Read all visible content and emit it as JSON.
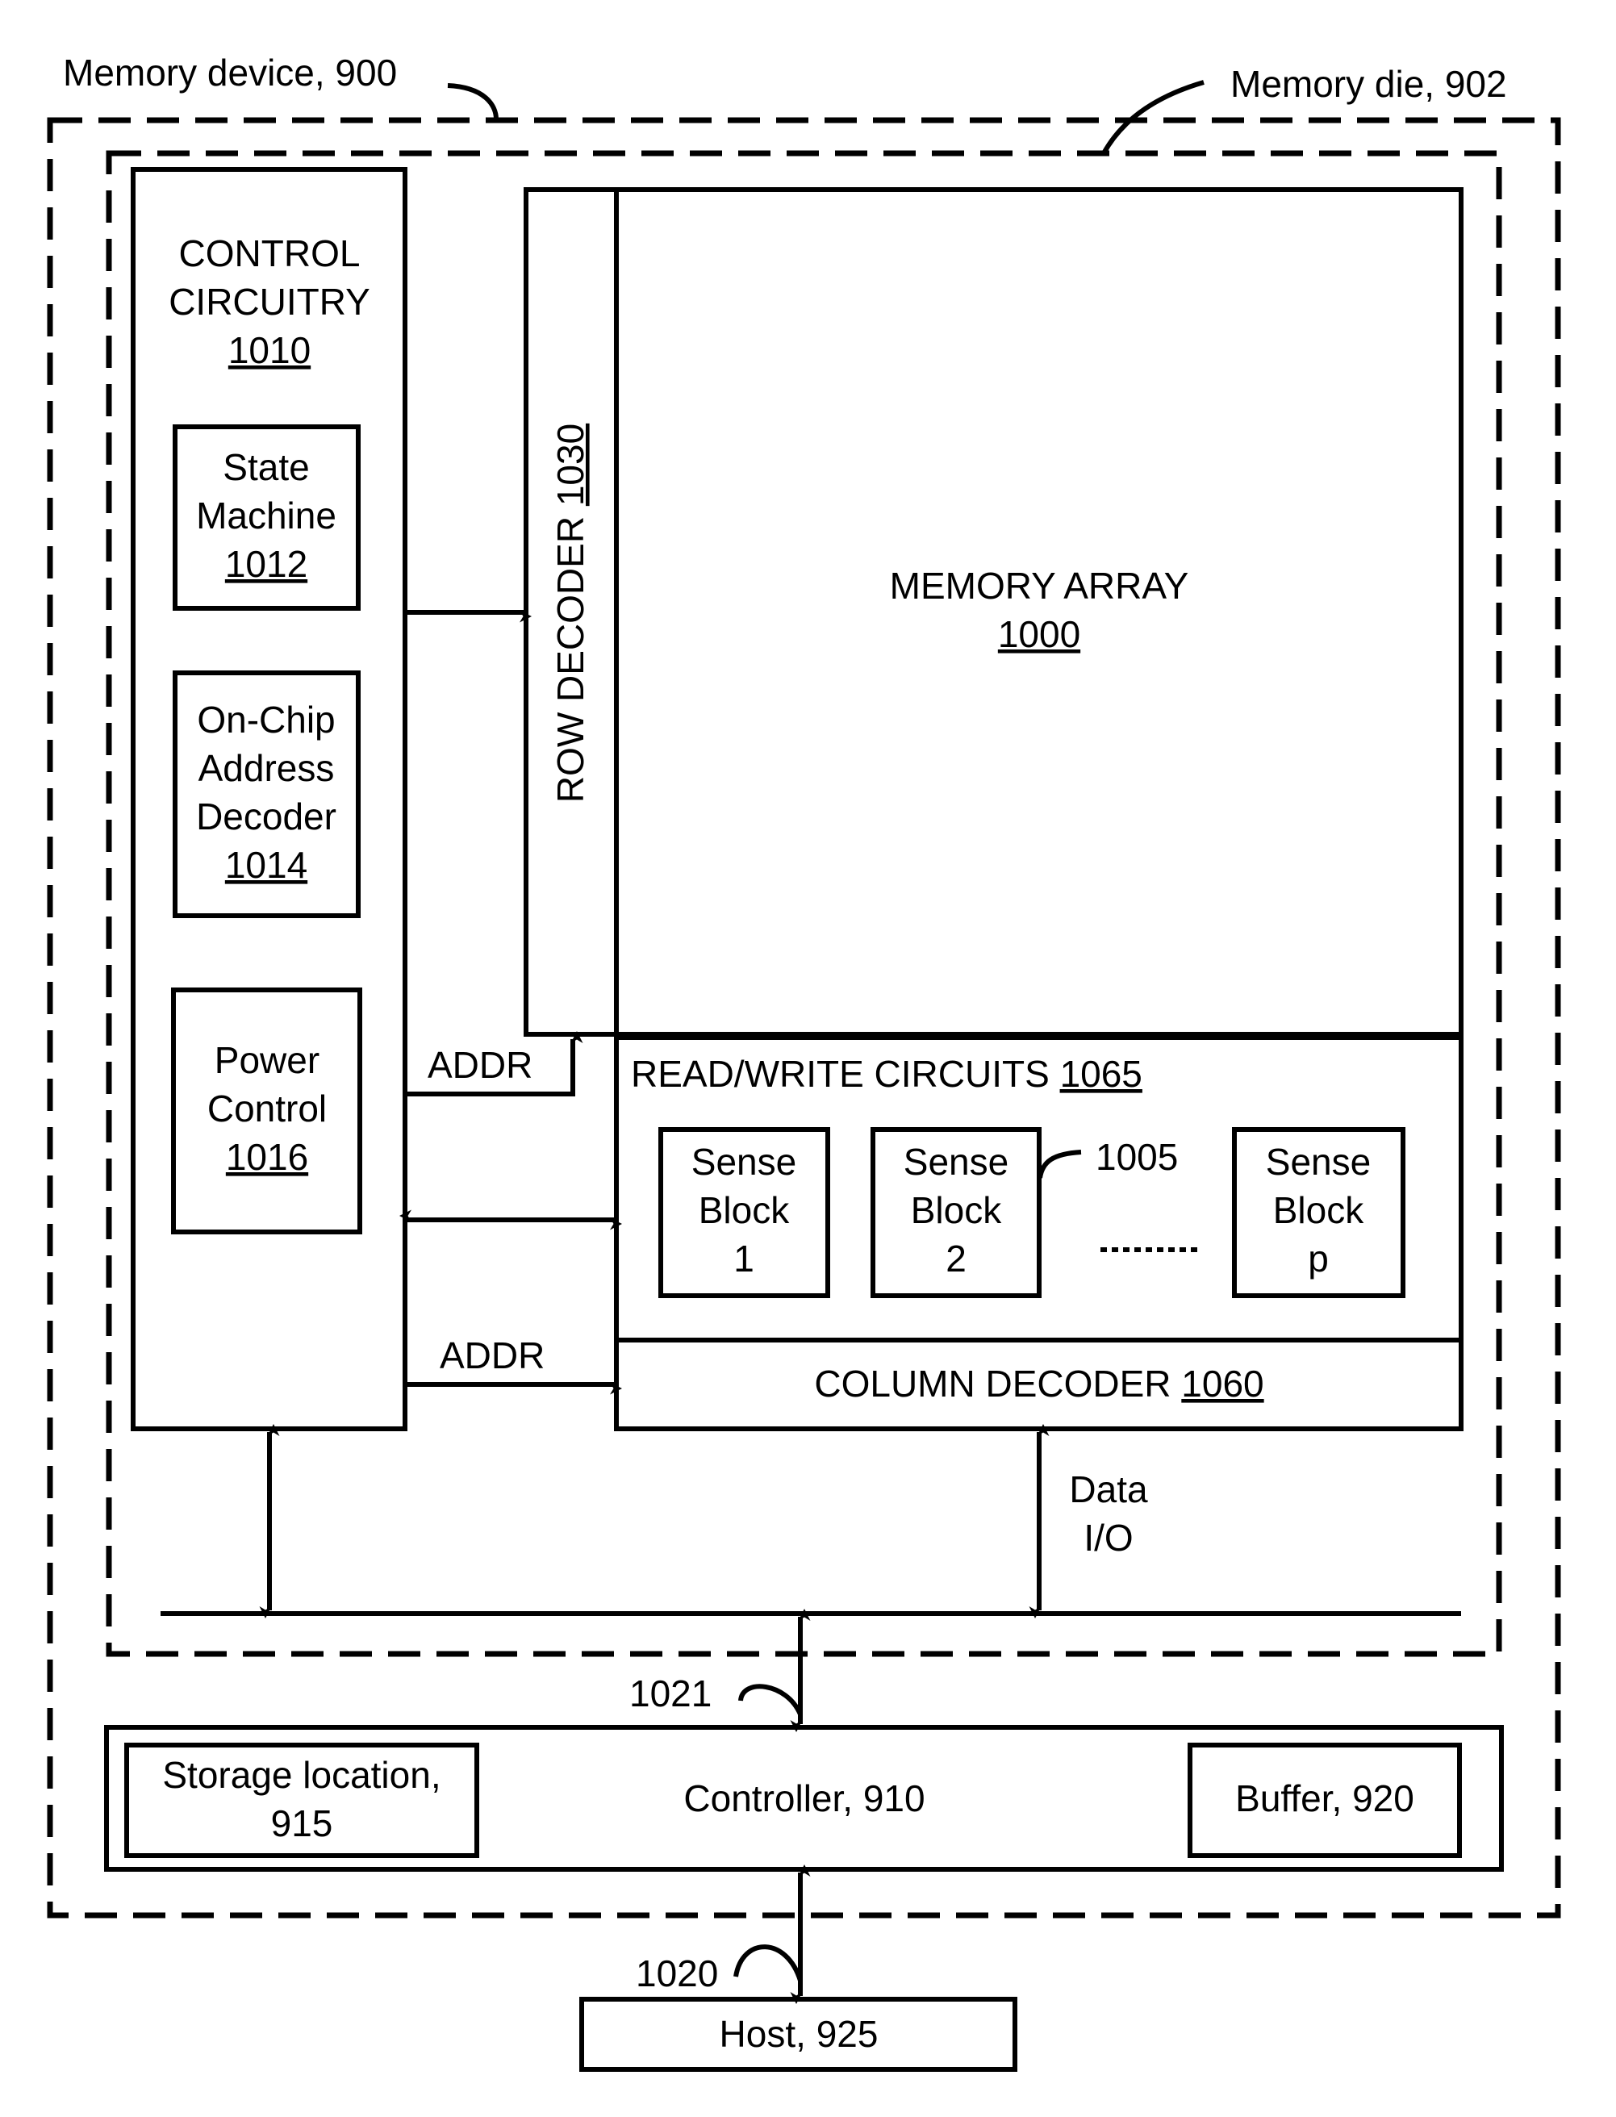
{
  "labels": {
    "memory_device": "Memory device, 900",
    "memory_die": "Memory die, 902"
  },
  "control_circuitry": {
    "line1": "CONTROL",
    "line2": "CIRCUITRY",
    "ref": "1010",
    "state_machine": {
      "line1": "State",
      "line2": "Machine",
      "ref": "1012"
    },
    "address_decoder": {
      "line1": "On-Chip",
      "line2": "Address",
      "line3": "Decoder",
      "ref": "1014"
    },
    "power_control": {
      "line1": "Power",
      "line2": "Control",
      "ref": "1016"
    }
  },
  "row_decoder": {
    "label": "ROW DECODER ",
    "ref": "1030"
  },
  "memory_array": {
    "label": "MEMORY ARRAY",
    "ref": "1000"
  },
  "read_write": {
    "label": "READ/WRITE CIRCUITS ",
    "ref": "1065"
  },
  "sense_blocks": [
    {
      "line1": "Sense",
      "line2": "Block",
      "line3": "1"
    },
    {
      "line1": "Sense",
      "line2": "Block",
      "line3": "2"
    },
    {
      "line1": "Sense",
      "line2": "Block",
      "line3": "p"
    }
  ],
  "sense_ref": "1005",
  "ellipsis": "---------",
  "column_decoder": {
    "label": "COLUMN DECODER ",
    "ref": "1060"
  },
  "addr_upper": "ADDR",
  "addr_lower": "ADDR",
  "data_io": {
    "line1": "Data",
    "line2": "I/O"
  },
  "bus_ref_internal": "1021",
  "bus_ref_host": "1020",
  "controller": {
    "label": "Controller, 910",
    "storage": {
      "line1": "Storage location,",
      "line2": "915"
    },
    "buffer": "Buffer, 920"
  },
  "host": "Host, 925"
}
